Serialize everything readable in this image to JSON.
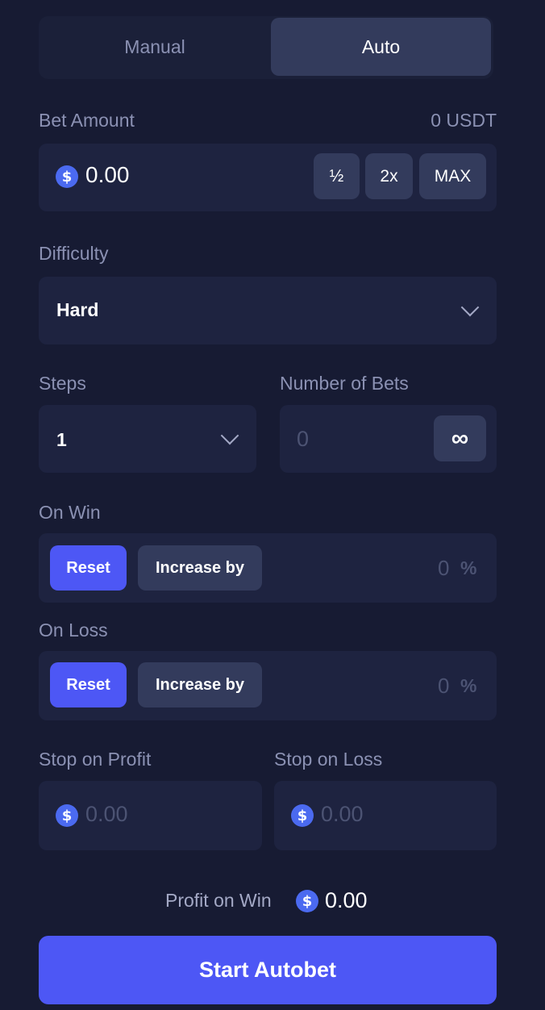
{
  "tabs": [
    {
      "label": "Manual",
      "active": false
    },
    {
      "label": "Auto",
      "active": true
    }
  ],
  "bet_amount": {
    "label": "Bet Amount",
    "balance": "0 USDT",
    "currency_symbol": "$",
    "value": "0.00",
    "half_label": "½",
    "double_label": "2x",
    "max_label": "MAX"
  },
  "difficulty": {
    "label": "Difficulty",
    "value": "Hard"
  },
  "steps": {
    "label": "Steps",
    "value": "1"
  },
  "number_of_bets": {
    "label": "Number of Bets",
    "placeholder": "0",
    "infinity_label": "∞"
  },
  "on_win": {
    "label": "On Win",
    "reset_label": "Reset",
    "increase_label": "Increase by",
    "value": "0",
    "unit": "%"
  },
  "on_loss": {
    "label": "On Loss",
    "reset_label": "Reset",
    "increase_label": "Increase by",
    "value": "0",
    "unit": "%"
  },
  "stop_on_profit": {
    "label": "Stop on Profit",
    "currency_symbol": "$",
    "placeholder": "0.00"
  },
  "stop_on_loss": {
    "label": "Stop on Loss",
    "currency_symbol": "$",
    "placeholder": "0.00"
  },
  "profit_on_win": {
    "label": "Profit on Win",
    "currency_symbol": "$",
    "value": "0.00"
  },
  "start_button_label": "Start Autobet",
  "colors": {
    "background": "#171b33",
    "field": "#1e2340",
    "accent": "#4d57f5",
    "coin": "#4b6af0"
  }
}
